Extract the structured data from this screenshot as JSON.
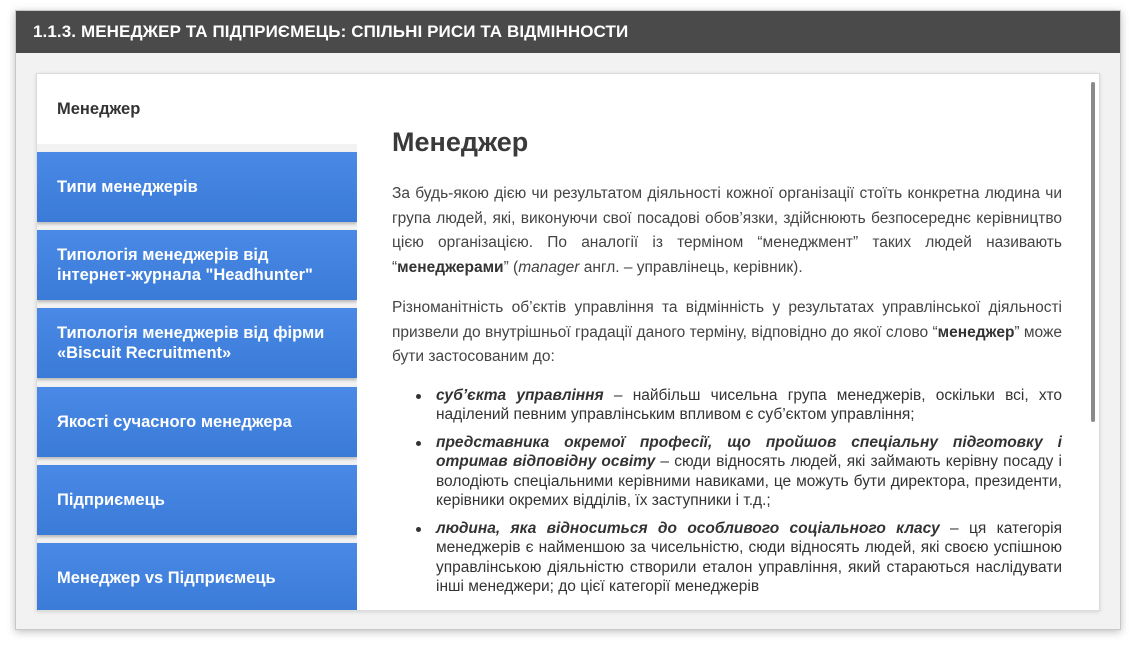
{
  "window": {
    "title": "1.1.3. МЕНЕДЖЕР ТА ПІДПРИЄМЕЦЬ: СПІЛЬНІ РИСИ ТА ВІДМІННОСТИ"
  },
  "sidebar": {
    "items": [
      {
        "label": "Менеджер",
        "active": true
      },
      {
        "label": "Типи менеджерів",
        "active": false
      },
      {
        "label": "Типологія менеджерів від інтернет-журнала \"Headhunter\"",
        "active": false
      },
      {
        "label": "Типологія менеджерів від фірми «Biscuit Recruitment»",
        "active": false
      },
      {
        "label": "Якості сучасного менеджера",
        "active": false
      },
      {
        "label": "Підприємець",
        "active": false
      },
      {
        "label": "Менеджер vs Підприємець",
        "active": false
      }
    ]
  },
  "content": {
    "heading": "Менеджер",
    "p1": {
      "text_a": "За будь-якою дією чи результатом діяльності кожної організації стоїть конкретна людина чи група людей, які, виконуючи свої посадові обов’язки, здійснюють безпосереднє керівництво цією організацією. По аналогії із терміном “менеджмент” таких людей називають “",
      "bold": "менеджерами",
      "text_b": "” (",
      "italic": "manager",
      "text_c": " англ. – управлінець, керівник)."
    },
    "p2": {
      "text_a": "Різноманітність об’єктів управління та відмінність у результатах управлінської діяльності призвели до внутрішньої градації даного терміну, відповідно до якої слово “",
      "bold": "менеджер",
      "text_b": "” може бути застосованим до:"
    },
    "list": [
      {
        "term": "суб’єкта управління",
        "text": " – найбільш чисельна група менеджерів, оскільки всі, хто наділений певним управлінським впливом є суб’єктом управління;"
      },
      {
        "term": "представника окремої професії, що пройшов спеціальну підготовку і отримав відповідну освіту",
        "text": " – сюди відносять людей, які займають керівну посаду і володіють спеціальними керівними навиками, це можуть бути директора, президенти, керівники окремих відділів, їх заступники і т.д.;"
      },
      {
        "term": "людина, яка відноситься до особливого соціального класу",
        "text": " – ця категорія менеджерів є найменшою за чисельністю, сюди відносять людей, які своєю успішною управлінською діяльністю створили еталон управління, який стараються наслідувати інші менеджери; до цієї категорії менеджерів"
      }
    ]
  },
  "colors": {
    "titlebar": "#4a4a4a",
    "nav_button": "#3b7bd8",
    "nav_active": "#ffffff"
  }
}
